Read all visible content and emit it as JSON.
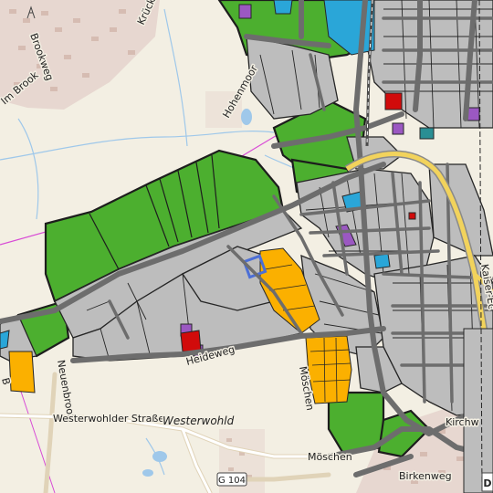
{
  "map": {
    "labels": {
      "krueckau": "Krückau",
      "brookweg": "Brookweg",
      "im_brook": "Im Brook",
      "hohenmoor": "Hohenmoor",
      "neuenbrook": "Neuenbrook",
      "heideweg": "Heideweg",
      "westerwohlder_strasse": "Westerwohlder Straße",
      "westerwohld": "Westerwohld",
      "moeschen_vertical": "Möschen",
      "moeschen": "Möschen",
      "g104": "G 104",
      "birkenweg": "Birkenweg",
      "kirchweg": "Kirchw",
      "kaiser_edge": "Kaiser-Ec",
      "d_edge": "D",
      "left_edge": "B"
    },
    "colors": {
      "background": "#f3efe3",
      "green_area": "#4caf2f",
      "built_area": "#bdbdbd",
      "commercial": "#fbb000",
      "water": "#2aa6d8",
      "special_use": "#9b58c2",
      "public": "#d10b0b",
      "highway": "#f2d35c",
      "boundary": "#d84bd6",
      "stream": "#9fc8ea"
    },
    "icons": {
      "tower": "radio-tower-icon"
    }
  }
}
